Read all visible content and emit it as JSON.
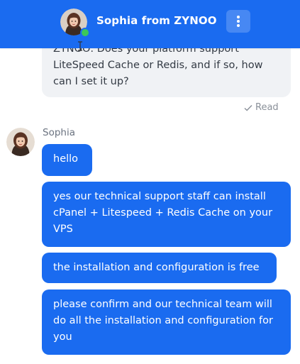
{
  "header": {
    "title": "Sophia from ZYNOO",
    "avatar_icon": "agent-avatar",
    "status": "online",
    "menu_icon": "more-vertical-icon",
    "background_color": "#1a6bf0",
    "status_color": "#3cc85a"
  },
  "conversation": {
    "previous_message": {
      "text": "ZYNOO: Does your platform support LiteSpeed Cache or Redis, and if so, how can I set it up?",
      "status": "Read",
      "status_icon": "check-icon"
    },
    "agent": {
      "name": "Sophia"
    },
    "messages": [
      {
        "text": "hello"
      },
      {
        "text": "yes our technical support staff can install cPanel + Litespeed + Redis Cache on your VPS"
      },
      {
        "text": "the installation and configuration is free"
      },
      {
        "text": "please confirm and our technical team will do all the installation and configuration for you"
      }
    ]
  }
}
